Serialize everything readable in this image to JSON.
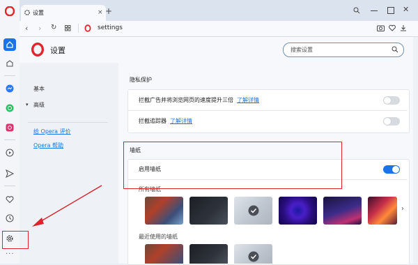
{
  "tab": {
    "title": "设置"
  },
  "address": {
    "url": "settings"
  },
  "header": {
    "title": "设置",
    "search_placeholder": "搜索设置"
  },
  "nav": {
    "basic": "基本",
    "advanced": "高级",
    "rate": "给 Opera 评价",
    "help": "Opera 帮助"
  },
  "privacy": {
    "heading": "隐私保护",
    "rows": [
      {
        "label": "拦截广告并将浏览网页的速度提升三倍",
        "link": "了解详情",
        "enabled": false
      },
      {
        "label": "拦截追踪器",
        "link": "了解详情",
        "enabled": false
      }
    ]
  },
  "wallpaper": {
    "heading": "墙纸",
    "enable_label": "启用墙纸",
    "enabled": true,
    "all_label": "所有墙纸",
    "recent_label": "最近使用的墙纸",
    "selected_index": 2
  },
  "colors": {
    "accent": "#1a73e8",
    "opera_red": "#e0262d",
    "annotation_red": "#d9262e"
  }
}
